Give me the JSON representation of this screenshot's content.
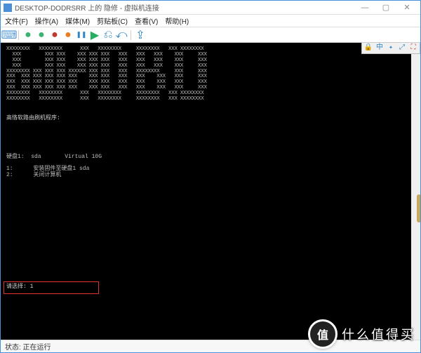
{
  "titlebar": {
    "title": "DESKTOP-DODRSRR 上的 隐修 - 虚拟机连接"
  },
  "menubar": {
    "file": "文件(F)",
    "action": "操作(A)",
    "media": "媒体(M)",
    "clipboard": "剪贴板(C)",
    "view": "查看(V)",
    "help": "帮助(H)"
  },
  "toolbar_icons": {
    "power_on": "●",
    "power_off": "●",
    "shutdown": "●",
    "save": "●",
    "pause": "❚❚",
    "reset": "▶",
    "checkpoint": "⎌",
    "revert": "⤺",
    "share": "⇪"
  },
  "mini_toolbar": {
    "lock": "🔒",
    "china": "中",
    "sym1": "✦",
    "sym2": "⤢",
    "full": "⛶"
  },
  "terminal": {
    "ascii": "XXXXXXXX   XXXXXXXX      XXX   XXXXXXXX     XXXXXXXX   XXX XXXXXXXX\n  XXX        XXX XXX    XXX XXX XXX   XXX   XXX   XXX    XXX     XXX\n  XXX        XXX XXX    XXX XXX XXX   XXX   XXX   XXX    XXX     XXX\n  XXX        XXX XXX    XXX XXX XXX   XXX   XXX   XXX    XXX     XXX\nXXXXXXXX XXX XXX XXX XXXXXX XXX XXX   XXX   XXXXXXXX     XXX     XXX\nXXX  XXX XXX XXX XXX XXX    XXX XXX   XXX   XXX    XXX   XXX     XXX\nXXX  XXX XXX XXX XXX XXX    XXX XXX   XXX   XXX    XXX   XXX     XXX\nXXX  XXX XXX XXX XXX XXX    XXX XXX   XXX   XXX    XXX   XXX     XXX\nXXXXXXXX   XXXXXXXX      XXX   XXXXXXXX     XXXXXXXX   XXX XXXXXXXX\nXXXXXXXX   XXXXXXXX      XXX   XXXXXXXX     XXXXXXXX   XXX XXXXXXXX",
    "program_label": "高恪软路由刷机程序:",
    "disk_line": "硬盘1:  sda       Virtual 10G",
    "option1": "1:      安装固件至硬盘1 sda",
    "option2": "2:      关闭计算机",
    "prompt_label": "请选择:",
    "prompt_value": "1"
  },
  "statusbar": {
    "status": "状态: 正在运行"
  },
  "watermark": {
    "logo_text": "值",
    "brand": "什么值得买"
  }
}
